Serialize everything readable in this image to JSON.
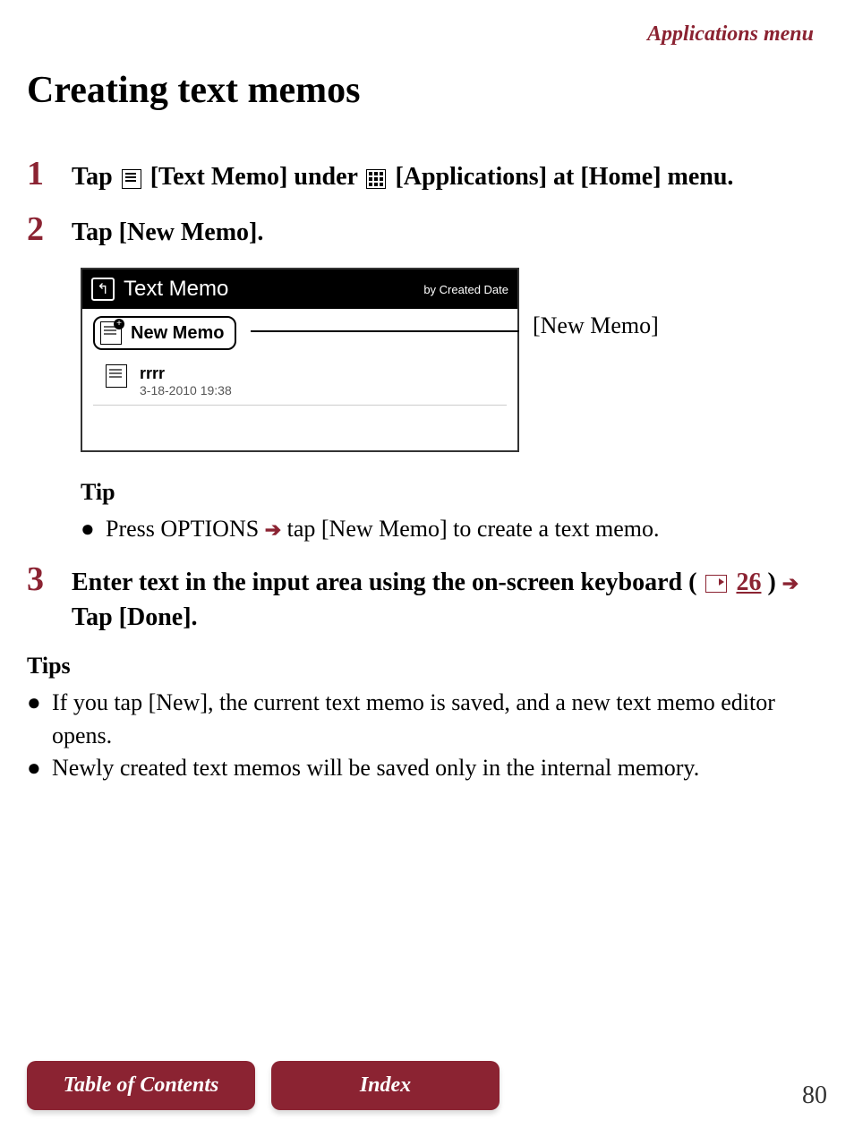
{
  "breadcrumb": "Applications menu",
  "title": "Creating text memos",
  "steps": {
    "step1": {
      "number": "1",
      "text_before_icon1": "Tap ",
      "text_after_icon1": " [Text Memo] under ",
      "text_after_icon2": " [Applications] at [Home] menu."
    },
    "step2": {
      "number": "2",
      "text": "Tap [New Memo]."
    },
    "step3": {
      "number": "3",
      "text_before_link": "Enter text in the input area using the on-screen keyboard (",
      "link_text": "26",
      "text_after_link": ") ",
      "text_after_arrow": " Tap [Done]."
    }
  },
  "screenshot": {
    "header_title": "Text Memo",
    "sort_label": "by Created Date",
    "new_memo_label": "New Memo",
    "memo_items": [
      {
        "title": "rrrr",
        "date": "3-18-2010 19:38"
      }
    ]
  },
  "callout": "[New Memo]",
  "tip_inline": {
    "title": "Tip",
    "text_before_arrow": "Press OPTIONS ",
    "text_after_arrow": " tap [New Memo] to create a text memo."
  },
  "tips_lower": {
    "title": "Tips",
    "items": [
      "If you tap [New], the current text memo is saved, and a new text memo editor opens.",
      "Newly created text memos will be saved only in the internal memory."
    ]
  },
  "nav": {
    "toc": "Table of Contents",
    "index": "Index"
  },
  "page_number": "80"
}
